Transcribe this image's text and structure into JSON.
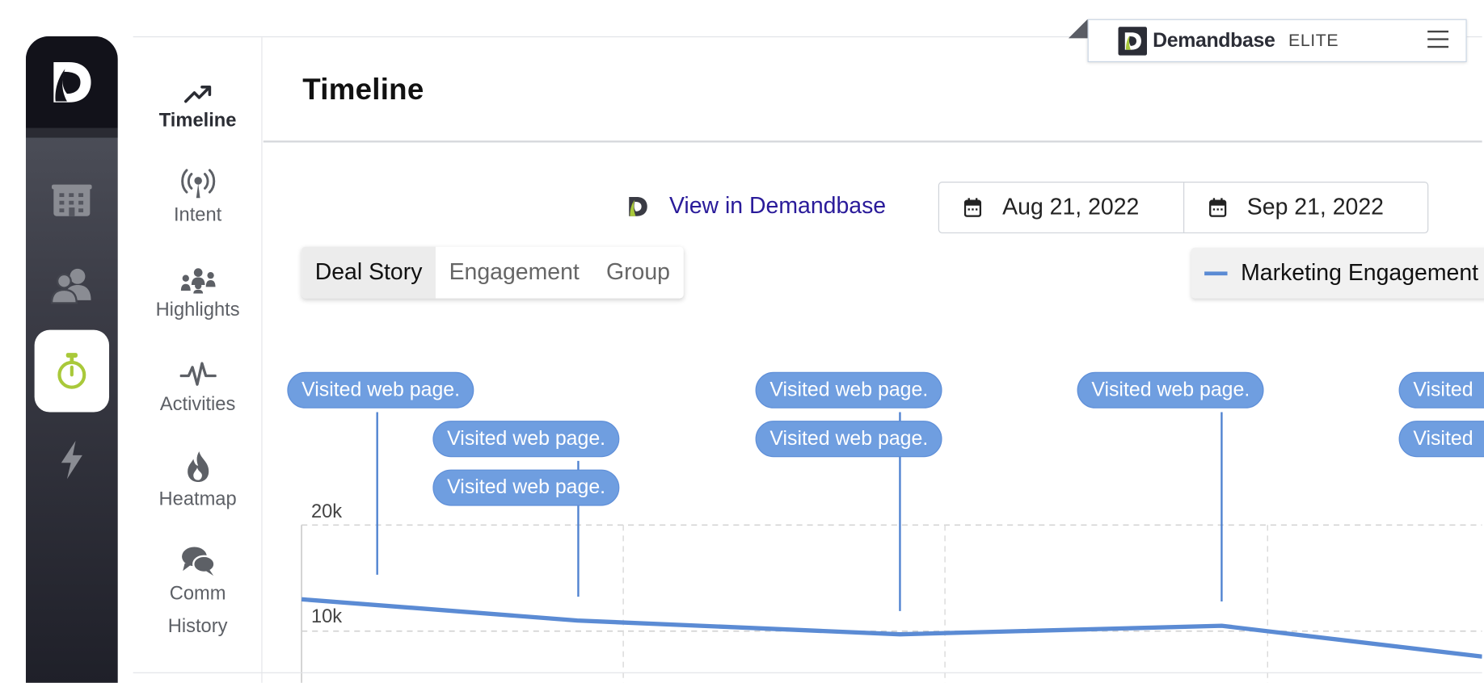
{
  "rail": {
    "items": [
      {
        "name": "company-icon"
      },
      {
        "name": "people-icon"
      },
      {
        "name": "stopwatch-icon",
        "active": true
      },
      {
        "name": "lightning-icon"
      }
    ],
    "accent": "#a9c93a"
  },
  "nav": {
    "items": [
      {
        "label": "Timeline",
        "icon": "trending-up-icon",
        "active": true
      },
      {
        "label": "Intent",
        "icon": "broadcast-icon"
      },
      {
        "label": "Highlights",
        "icon": "group-icon"
      },
      {
        "label": "Activities",
        "icon": "pulse-icon"
      },
      {
        "label": "Heatmap",
        "icon": "flame-icon"
      },
      {
        "label": "Comm\nHistory",
        "icon": "chat-bubbles-icon"
      }
    ]
  },
  "header": {
    "title": "Timeline"
  },
  "brand": {
    "name": "Demandbase",
    "tier": "ELITE"
  },
  "toolbar": {
    "view_link": "View in Demandbase",
    "start_date": "Aug 21, 2022",
    "end_date": "Sep 21, 2022"
  },
  "tabs": [
    "Deal Story",
    "Engagement",
    "Group"
  ],
  "legend": {
    "label": "Marketing Engagement"
  },
  "events": {
    "label": "Visited web page.",
    "label_truncated": "Visited"
  },
  "chart_data": {
    "type": "line",
    "series": [
      {
        "name": "Marketing Engagement",
        "color": "#5b8bd4",
        "values": [
          13000,
          11000,
          9700,
          10500,
          7600
        ]
      }
    ],
    "x": [
      "",
      "",
      "",
      "",
      ""
    ],
    "yticks": [
      "10k",
      "20k"
    ],
    "ylim": [
      0,
      30000
    ],
    "grid": true
  }
}
